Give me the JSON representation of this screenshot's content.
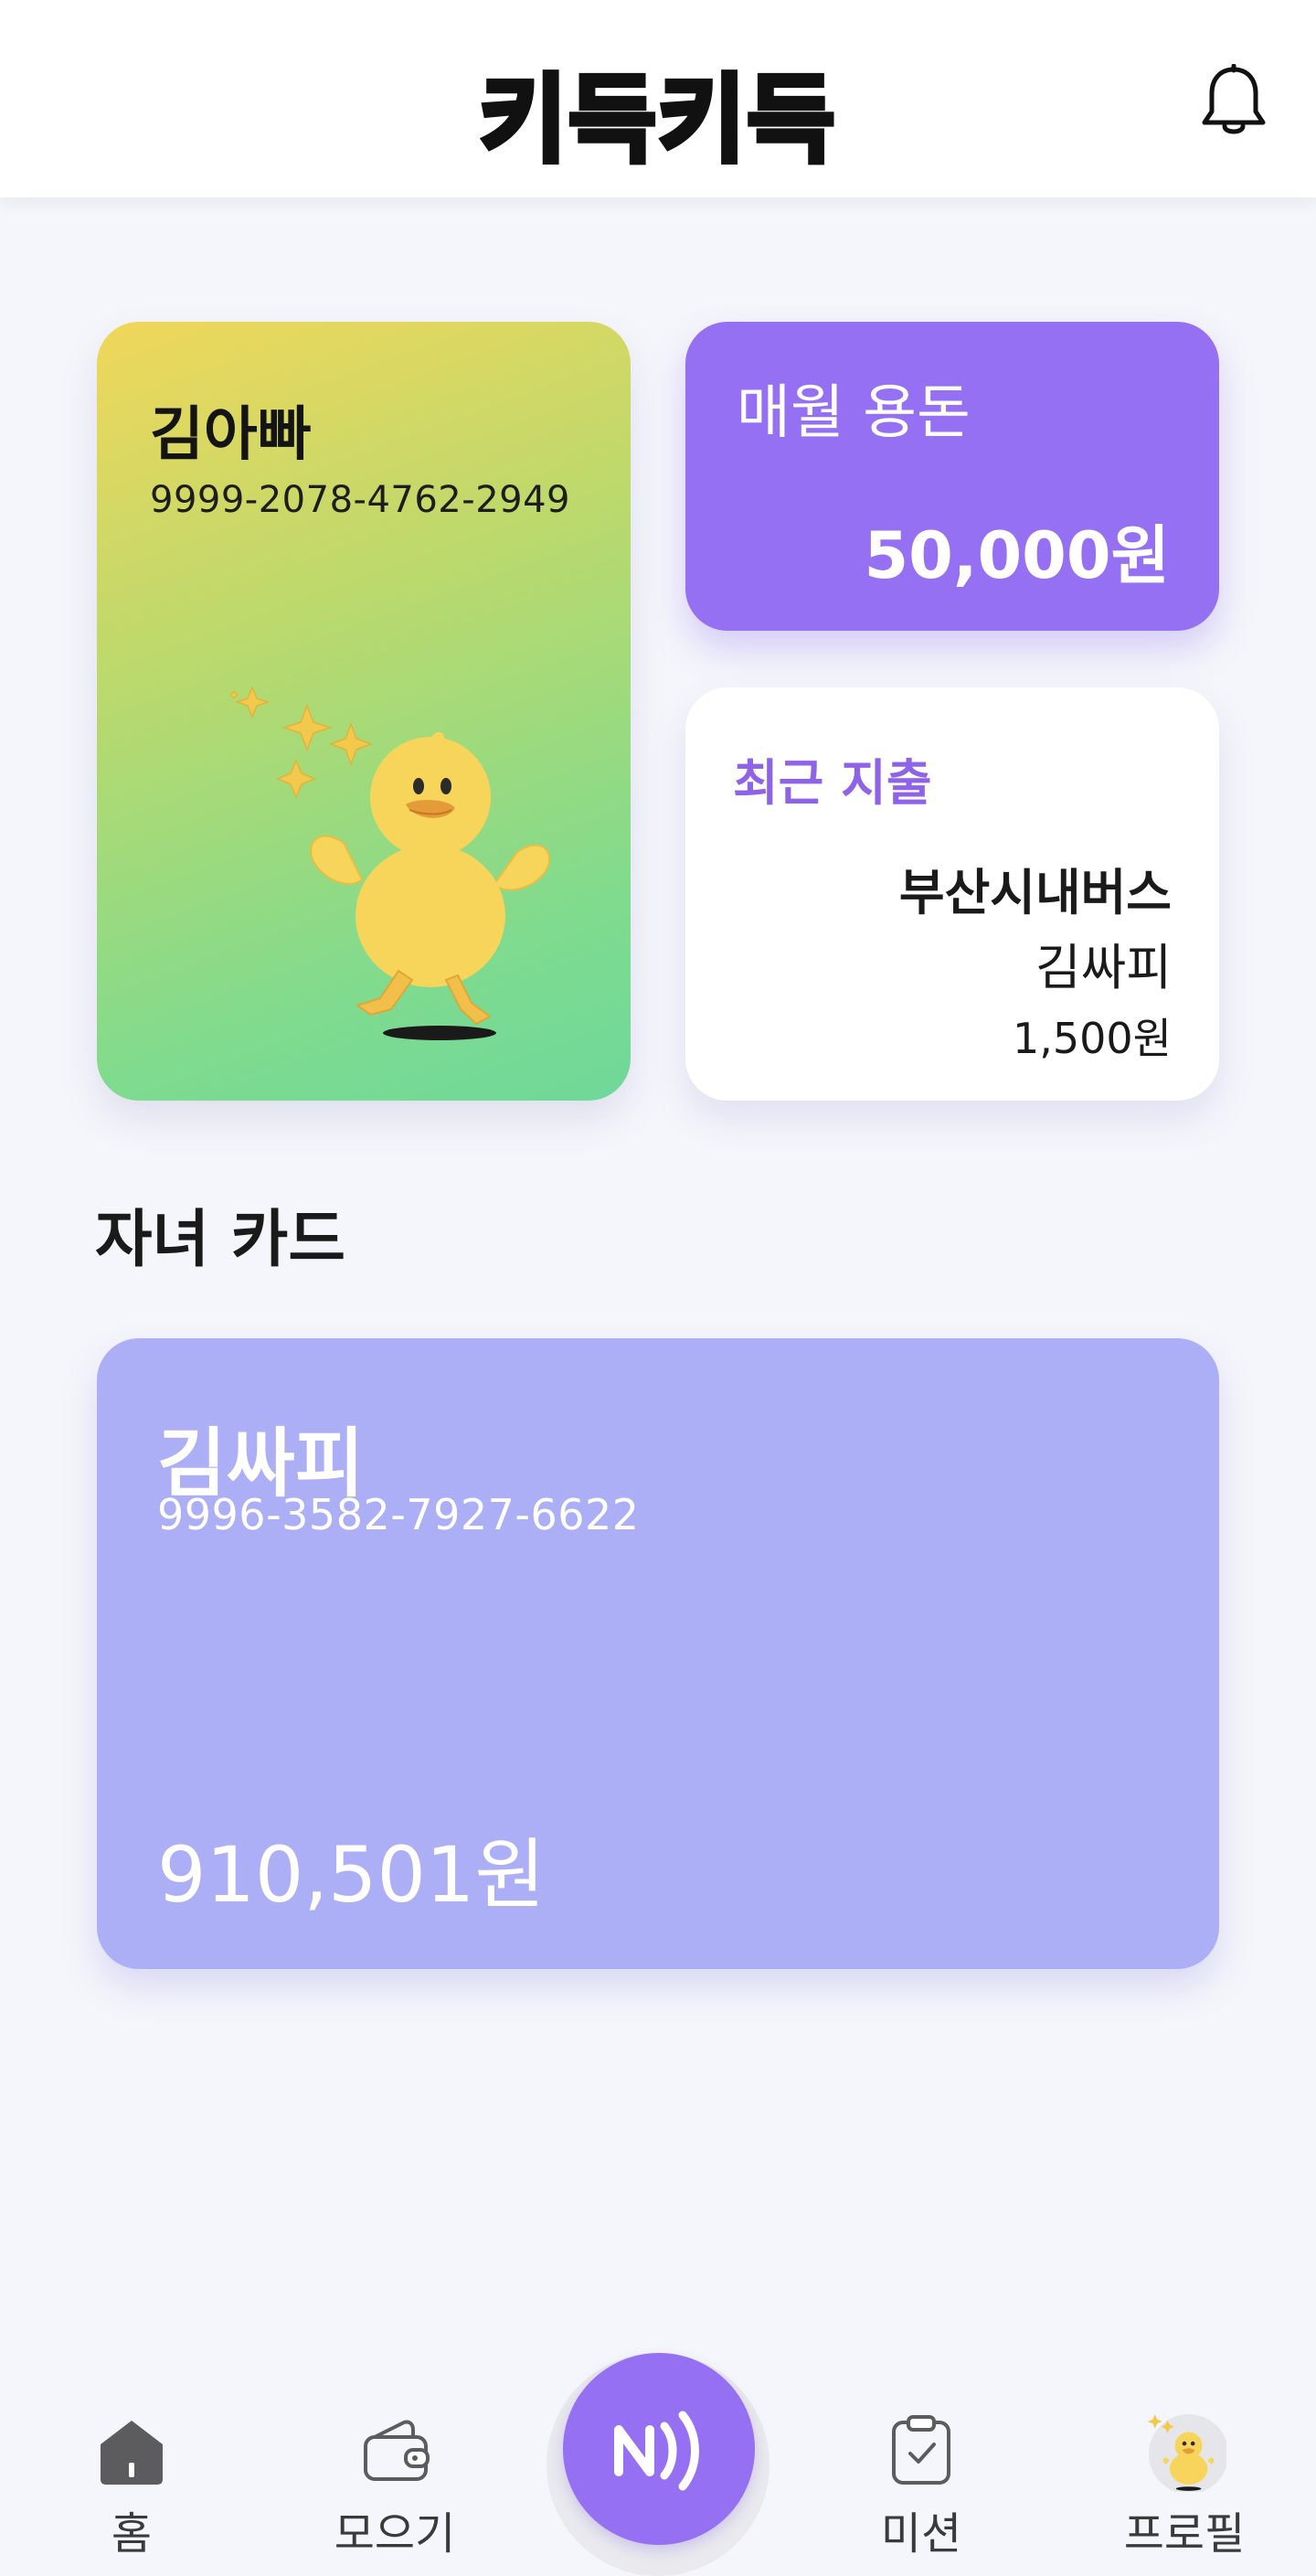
{
  "header": {
    "logo_text": "키득키득",
    "bell_icon": "bell-icon"
  },
  "parent_card": {
    "name": "김아빠",
    "number": "9999-2078-4762-2949",
    "illustration": "duck-illustration"
  },
  "allowance_card": {
    "label": "매월 용돈",
    "amount": "50,000원"
  },
  "recent_spending": {
    "label": "최근 지출",
    "merchant": "부산시내버스",
    "user": "김싸피",
    "amount": "1,500원"
  },
  "section": {
    "title": "자녀 카드"
  },
  "child_card": {
    "name": "김싸피",
    "number": "9996-3582-7927-6622",
    "balance": "910,501원"
  },
  "nav": {
    "items": [
      {
        "label": "홈",
        "icon": "home-icon"
      },
      {
        "label": "모으기",
        "icon": "wallet-icon"
      },
      {
        "label": "",
        "icon": "nfc-icon"
      },
      {
        "label": "미션",
        "icon": "clipboard-check-icon"
      },
      {
        "label": "프로필",
        "icon": "duck-avatar-icon"
      }
    ]
  },
  "colors": {
    "accent": "#9570f2",
    "child_card": "#acaef6",
    "background": "#f5f6fb",
    "recent_label": "#8f63e8"
  }
}
